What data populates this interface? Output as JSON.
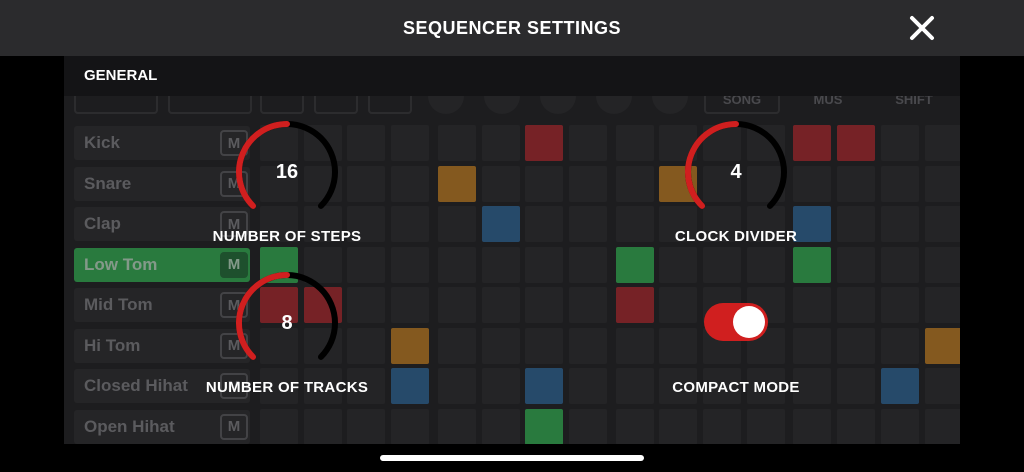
{
  "header": {
    "title": "SEQUENCER SETTINGS",
    "close_icon": "close-icon"
  },
  "section": {
    "title": "GENERAL"
  },
  "settings": {
    "steps": {
      "label": "NUMBER OF STEPS",
      "value": "16",
      "fraction": 0.5
    },
    "clock": {
      "label": "CLOCK DIVIDER",
      "value": "4",
      "fraction": 0.5
    },
    "tracks": {
      "label": "NUMBER OF TRACKS",
      "value": "8",
      "fraction": 0.5
    },
    "compact": {
      "label": "COMPACT MODE",
      "on": true
    }
  },
  "background": {
    "strip_labels": [
      "SONG",
      "MUS",
      "SHIFT"
    ],
    "tracks": [
      {
        "name": "Kick",
        "mute": "M",
        "active": false
      },
      {
        "name": "Snare",
        "mute": "M",
        "active": false
      },
      {
        "name": "Clap",
        "mute": "M",
        "active": false
      },
      {
        "name": "Low Tom",
        "mute": "M",
        "active": true
      },
      {
        "name": "Mid Tom",
        "mute": "M",
        "active": false
      },
      {
        "name": "Hi Tom",
        "mute": "M",
        "active": false
      },
      {
        "name": "Closed Hihat",
        "mute": "M",
        "active": false
      },
      {
        "name": "Open Hihat",
        "mute": "M",
        "active": false
      }
    ],
    "colored_steps": [
      {
        "row": 0,
        "col": 6,
        "color": "#c0272d"
      },
      {
        "row": 0,
        "col": 12,
        "color": "#c0272d"
      },
      {
        "row": 0,
        "col": 13,
        "color": "#c0272d"
      },
      {
        "row": 1,
        "col": 4,
        "color": "#d98b1f"
      },
      {
        "row": 1,
        "col": 9,
        "color": "#d98b1f"
      },
      {
        "row": 2,
        "col": 5,
        "color": "#2f6fa8"
      },
      {
        "row": 2,
        "col": 12,
        "color": "#2f6fa8"
      },
      {
        "row": 3,
        "col": 0,
        "color": "#34c759"
      },
      {
        "row": 3,
        "col": 8,
        "color": "#34c759"
      },
      {
        "row": 3,
        "col": 12,
        "color": "#34c759"
      },
      {
        "row": 4,
        "col": 0,
        "color": "#c0272d"
      },
      {
        "row": 4,
        "col": 1,
        "color": "#c0272d"
      },
      {
        "row": 4,
        "col": 8,
        "color": "#c0272d"
      },
      {
        "row": 5,
        "col": 3,
        "color": "#d98b1f"
      },
      {
        "row": 5,
        "col": 15,
        "color": "#d98b1f"
      },
      {
        "row": 6,
        "col": 3,
        "color": "#2f6fa8"
      },
      {
        "row": 6,
        "col": 6,
        "color": "#2f6fa8"
      },
      {
        "row": 6,
        "col": 14,
        "color": "#2f6fa8"
      },
      {
        "row": 7,
        "col": 6,
        "color": "#34c759"
      }
    ]
  },
  "colors": {
    "accent": "#d01f1f",
    "knob_track": "#000000",
    "header_bg": "#2b2b2d"
  }
}
